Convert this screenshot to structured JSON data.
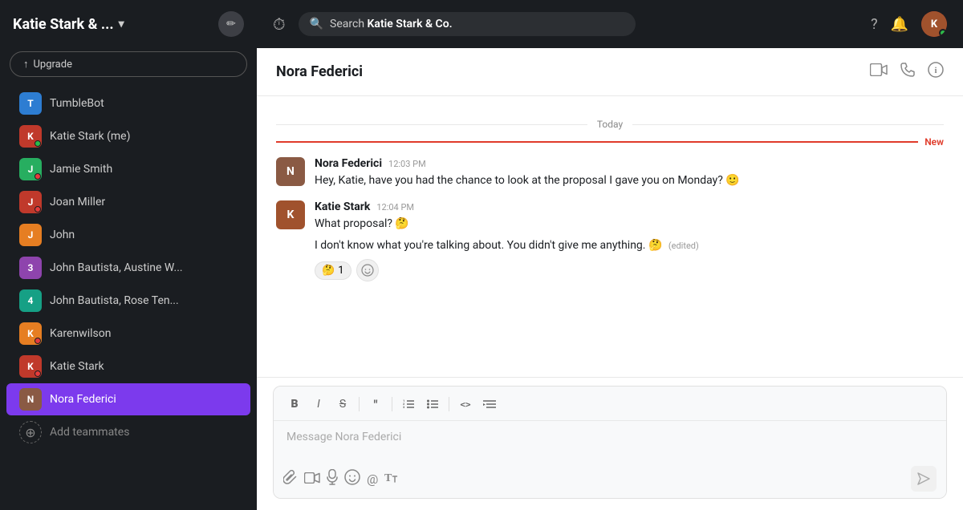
{
  "workspace": {
    "name": "Katie Stark & ...",
    "edit_label": "✏"
  },
  "upgrade": {
    "label": "Upgrade",
    "arrow": "↑"
  },
  "sidebar": {
    "items": [
      {
        "id": "tumblebot",
        "name": "TumbleBot",
        "status": "none",
        "initials": "T",
        "color": "av-blue"
      },
      {
        "id": "katie-stark-me",
        "name": "Katie Stark (me)",
        "status": "online",
        "initials": "K",
        "color": "av-pink"
      },
      {
        "id": "jamie-smith",
        "name": "Jamie Smith",
        "status": "dnd",
        "initials": "J",
        "color": "av-green"
      },
      {
        "id": "joan-miller",
        "name": "Joan Miller",
        "status": "dnd",
        "initials": "J",
        "color": "av-pink"
      },
      {
        "id": "john",
        "name": "John",
        "status": "none",
        "initials": "J",
        "color": "av-orange"
      },
      {
        "id": "john-bautista-austine",
        "name": "John Bautista, Austine W...",
        "status": "none",
        "initials": "3",
        "color": "av-purple"
      },
      {
        "id": "john-bautista-rose",
        "name": "John Bautista, Rose Ten...",
        "status": "none",
        "initials": "4",
        "color": "av-teal"
      },
      {
        "id": "karenwilson",
        "name": "Karenwilson",
        "status": "dnd",
        "initials": "K",
        "color": "av-orange"
      },
      {
        "id": "katie-stark",
        "name": "Katie Stark",
        "status": "dnd",
        "initials": "K",
        "color": "av-red"
      },
      {
        "id": "nora-federici",
        "name": "Nora Federici",
        "status": "none",
        "initials": "N",
        "color": "av-nora",
        "active": true
      }
    ],
    "add_teammates": "Add teammates"
  },
  "topbar": {
    "search_placeholder": "Search",
    "search_workspace": "Katie Stark & Co.",
    "help_icon": "?",
    "notification_icon": "🔔"
  },
  "chat": {
    "contact_name": "Nora Federici",
    "date_label": "Today",
    "new_label": "New",
    "messages": [
      {
        "id": "msg1",
        "author": "Nora Federici",
        "time": "12:03 PM",
        "text": "Hey, Katie, have you had the chance to look at the proposal I gave you on Monday? 🙂",
        "avatar_color": "av-nora",
        "avatar_initials": "N"
      },
      {
        "id": "msg2",
        "author": "Katie Stark",
        "time": "12:04 PM",
        "text": "What proposal? 🤔",
        "avatar_color": "av-red",
        "avatar_initials": "K"
      },
      {
        "id": "msg3",
        "author": "",
        "time": "",
        "text": "I don't know what you're talking about. You didn't give me anything. 🤔",
        "edited": "(edited)",
        "avatar_color": "av-red",
        "avatar_initials": "K",
        "reaction_emoji": "🤔",
        "reaction_count": "1"
      }
    ],
    "input_placeholder": "Message Nora Federici",
    "toolbar": {
      "bold": "B",
      "italic": "I",
      "strikethrough": "S̶",
      "quote": "❝",
      "list_ordered": "≡",
      "list_unordered": "⊞",
      "code": "<>",
      "indent": "⇥"
    }
  }
}
